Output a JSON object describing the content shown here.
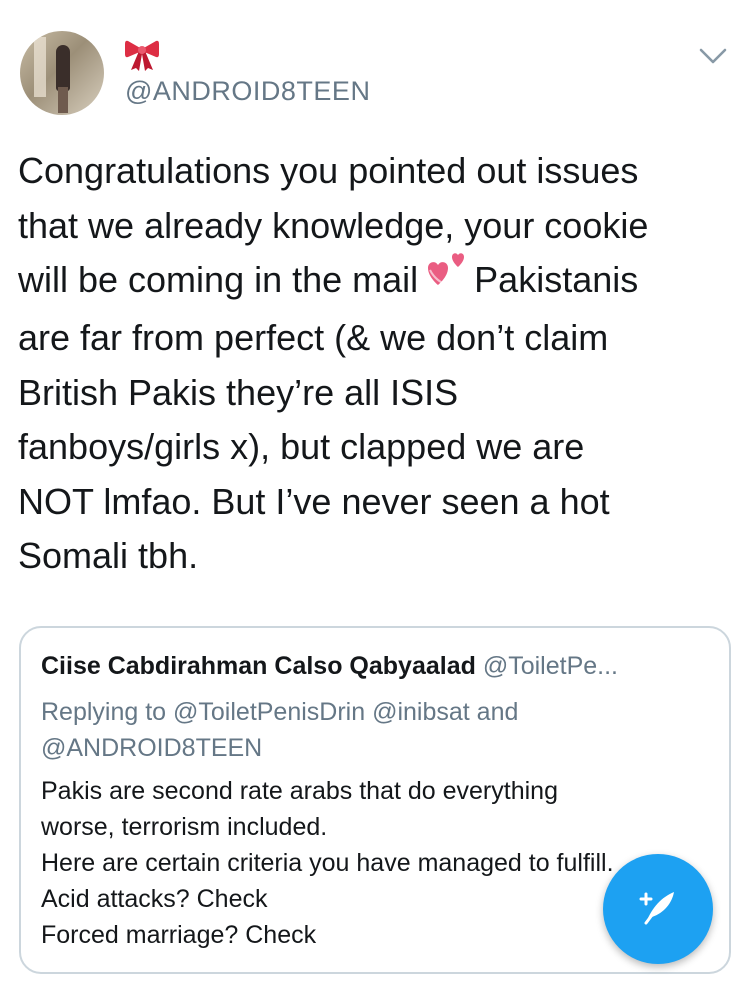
{
  "author": {
    "handle": "@ANDROID8TEEN",
    "emoji_icon": "ribbon-icon"
  },
  "tweet": {
    "lines": [
      "Congratulations you pointed out issues",
      "that we already knowledge, your cookie",
      "will be coming in the mail",
      "Pakistanis",
      "are far from perfect (& we don’t claim",
      "British Pakis they’re all ISIS",
      "fanboys/girls x), but clapped we are",
      "NOT lmfao. But I’ve never seen a hot",
      "Somali tbh."
    ],
    "inline_emoji": "two-hearts-icon"
  },
  "quoted_tweet": {
    "name": "Ciise Cabdirahman Calso Qabyaalad",
    "handle": "@ToiletPe...",
    "reply_line_1": "Replying to @ToiletPenisDrin @inibsat and",
    "reply_line_2": "@ANDROID8TEEN",
    "body": [
      "Pakis are second rate arabs that do everything",
      "worse, terrorism included.",
      "Here are certain criteria you have managed to fulfill.",
      "Acid attacks? Check",
      "Forced marriage? Check"
    ]
  },
  "colors": {
    "accent": "#1da1f2",
    "secondary_text": "#657786",
    "border": "#ccd6dd"
  }
}
